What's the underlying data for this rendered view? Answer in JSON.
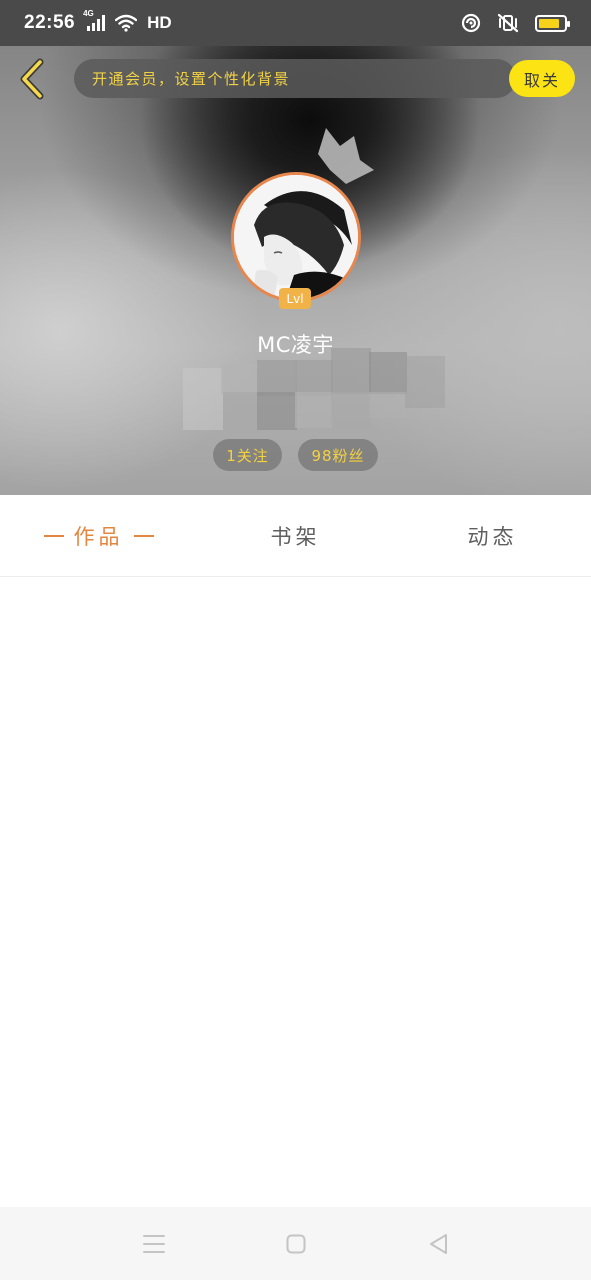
{
  "status_bar": {
    "time": "22:56",
    "network": "4G",
    "hd_label": "HD",
    "battery_level": 0.85,
    "battery_color": "#f6d21a"
  },
  "header": {
    "back_icon": "chevron-left-icon",
    "promo_text": "开通会员，设置个性化背景",
    "follow_button": "取关"
  },
  "profile": {
    "level": "Lvl",
    "username": "MC凌宇",
    "following": "1关注",
    "fans": "98粉丝"
  },
  "tabs": [
    {
      "label": "作品",
      "active": true
    },
    {
      "label": "书架",
      "active": false
    },
    {
      "label": "动态",
      "active": false
    }
  ],
  "colors": {
    "accent": "#e38640",
    "promo_text": "#f2d244",
    "follow_button_bg": "#fbe314",
    "level_badge": "#f1b348"
  },
  "nav_bar": {
    "icons": [
      "menu-icon",
      "home-square-icon",
      "back-triangle-icon"
    ]
  }
}
